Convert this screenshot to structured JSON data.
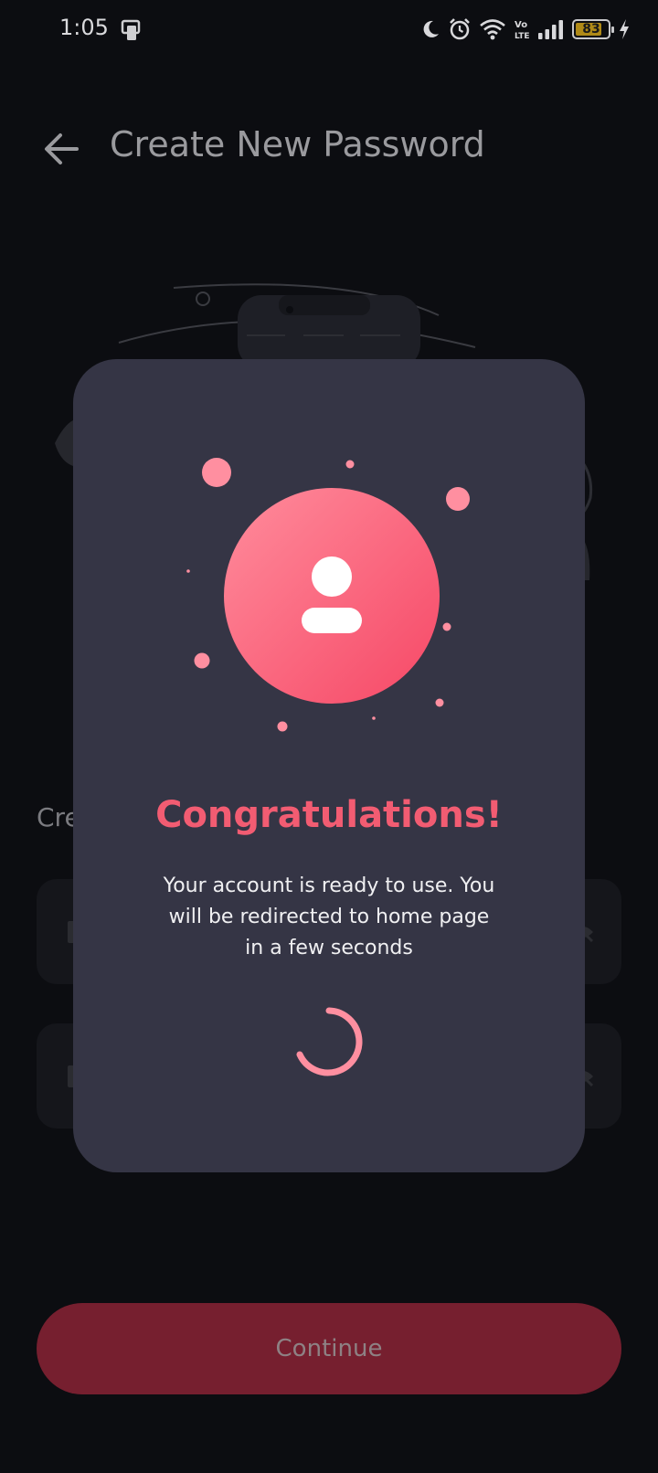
{
  "status_bar": {
    "time": "1:05",
    "battery": "83",
    "battery_level": 0.83,
    "icons": [
      "screen-share-icon",
      "moon-icon",
      "alarm-icon",
      "wifi-icon",
      "volte-icon",
      "signal-icon",
      "battery-icon",
      "charging-icon"
    ]
  },
  "header": {
    "title": "Create New Password",
    "back_icon": "arrow-left-icon"
  },
  "form": {
    "section_label": "Cre",
    "fields": [
      {
        "icon": "lock-icon",
        "action_icon": "eye-off-icon"
      },
      {
        "icon": "lock-icon",
        "action_icon": "eye-off-icon"
      }
    ]
  },
  "footer": {
    "continue_label": "Continue"
  },
  "modal": {
    "title": "Congratulations!",
    "message": "Your account is ready to use. You will be redirected to home page in a few seconds",
    "icon": "user-icon",
    "loading_icon": "spinner-icon"
  },
  "colors": {
    "background": "#0c0d11",
    "modal_background": "#353545",
    "accent": "#f25c72",
    "continue_button": "#761f2f"
  }
}
